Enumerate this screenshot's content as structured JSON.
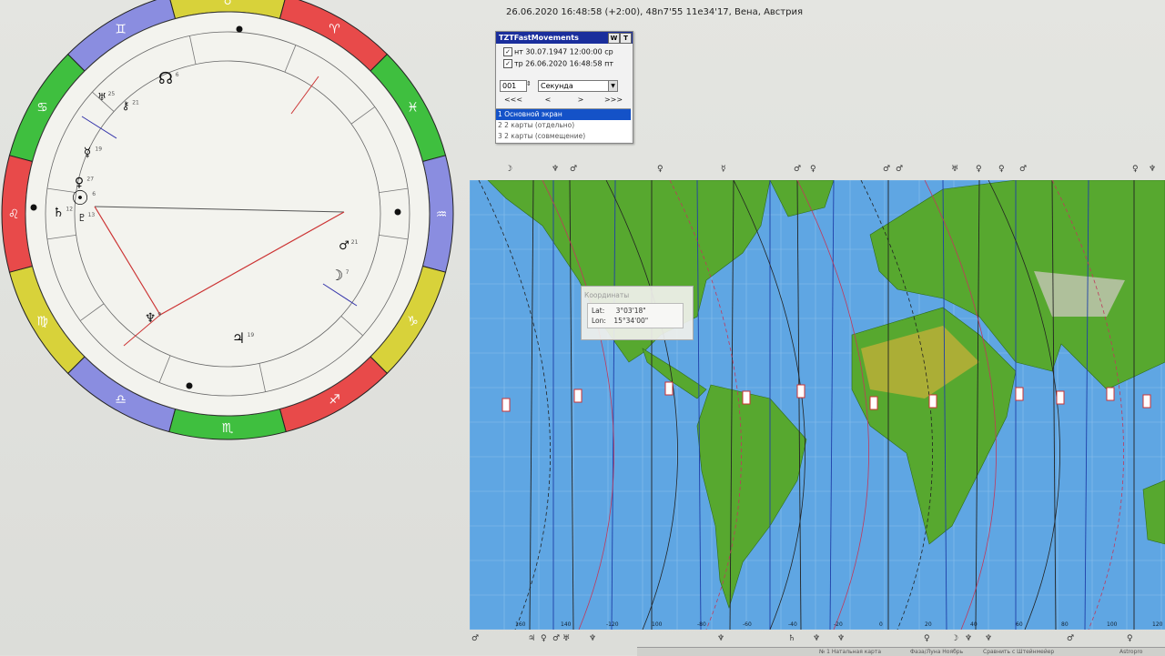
{
  "header": {
    "info": "26.06.2020 16:48:58 (+2:00), 48n7'55 11e34'17, Вена, Австрия"
  },
  "dialog": {
    "title": "TZTFastMovements",
    "btn_w": "W",
    "btn_t": "T",
    "dates": [
      {
        "text": "нт 30.07.1947 12:00:00 ср",
        "checked": true
      },
      {
        "text": "тр 26.06.2020 16:48:58 пт",
        "checked": true
      }
    ],
    "check_mark": "✓",
    "step_value": "001",
    "step_unit": "Секунда",
    "nav": [
      "<<<",
      "<",
      ">",
      ">>>"
    ],
    "modes": [
      "1 Основной экран",
      "2 2 карты (отдельно)",
      "3 2 карты (совмещение)"
    ]
  },
  "coords": {
    "title": "Координаты",
    "lat_label": "Lat:",
    "lat_value": "3°03'18\"",
    "lon_label": "Lon:",
    "lon_value": "15°34'00\""
  },
  "wheel": {
    "ring_colors": [
      "#3fbf3f",
      "#8a8de0",
      "#d8d23a",
      "#e84a4a"
    ],
    "ring_signs": [
      "♋",
      "♊",
      "♉",
      "♈",
      "♓",
      "♒",
      "♑",
      "♐",
      "♏",
      "♎",
      "♍",
      "♌"
    ],
    "planets": [
      {
        "glyph": "☉",
        "deg": "6"
      },
      {
        "glyph": "☽",
        "deg": "7"
      },
      {
        "glyph": "☿",
        "deg": "19"
      },
      {
        "glyph": "♀",
        "deg": "27"
      },
      {
        "glyph": "♂",
        "deg": "21"
      },
      {
        "glyph": "♃",
        "deg": "19"
      },
      {
        "glyph": "♄",
        "deg": "12"
      },
      {
        "glyph": "♅",
        "deg": "25"
      },
      {
        "glyph": "♆",
        "deg": "9"
      },
      {
        "glyph": "☊",
        "deg": "6"
      },
      {
        "glyph": "⚷",
        "deg": "21"
      },
      {
        "glyph": "♇",
        "deg": "13"
      }
    ]
  },
  "map": {
    "top_planets": [
      "☽",
      "♆",
      "♂",
      "♀",
      "☿",
      "♂",
      "♀",
      "♂",
      "♂",
      "♅",
      "♀",
      "♀",
      "♂",
      "♀",
      "♆"
    ],
    "bottom_planets": [
      "♂",
      "♃",
      "♀",
      "♂",
      "♅",
      "♆",
      "♆",
      "♄",
      "♆",
      "♆",
      "♀",
      "☽",
      "♆",
      "♆",
      "♂",
      "♀"
    ],
    "lon_ticks": [
      "160",
      "140",
      "-120",
      "100",
      "-80",
      "-60",
      "-40",
      "-20",
      "0",
      "20",
      "40",
      "60",
      "80",
      "100",
      "120"
    ],
    "colors": {
      "ocean": "#5fa6e3",
      "land": "#57a82f",
      "desert": "#c7b03a",
      "line_blue": "#1f3fa8",
      "line_red": "#c0395b",
      "line_black": "#222222"
    }
  },
  "taskbar": {
    "items": [
      "№ 1 Натальная карта",
      "Фаза/Луна Ноябрь",
      "Сравнить с Штейнмейер",
      "Astropro"
    ]
  }
}
